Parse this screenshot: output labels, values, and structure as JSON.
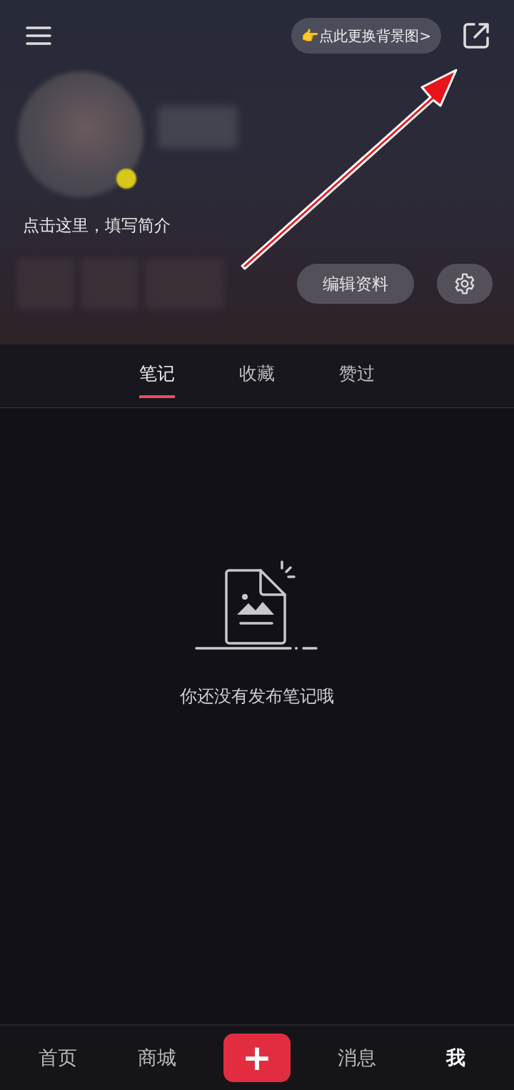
{
  "header": {
    "background_button": "👉点此更换背景图>",
    "bio_prompt": "点击这里，填写简介",
    "edit_button": "编辑资料"
  },
  "tabs": [
    {
      "label": "笔记",
      "selected": true
    },
    {
      "label": "收藏",
      "selected": false
    },
    {
      "label": "赞过",
      "selected": false
    }
  ],
  "empty_state": {
    "message": "你还没有发布笔记哦"
  },
  "bottom_nav": [
    {
      "kind": "tab",
      "label": "首页",
      "selected": false
    },
    {
      "kind": "tab",
      "label": "商城",
      "selected": false
    },
    {
      "kind": "add",
      "label": "+",
      "selected": false
    },
    {
      "kind": "tab",
      "label": "消息",
      "selected": false
    },
    {
      "kind": "tab",
      "label": "我",
      "selected": true
    }
  ]
}
